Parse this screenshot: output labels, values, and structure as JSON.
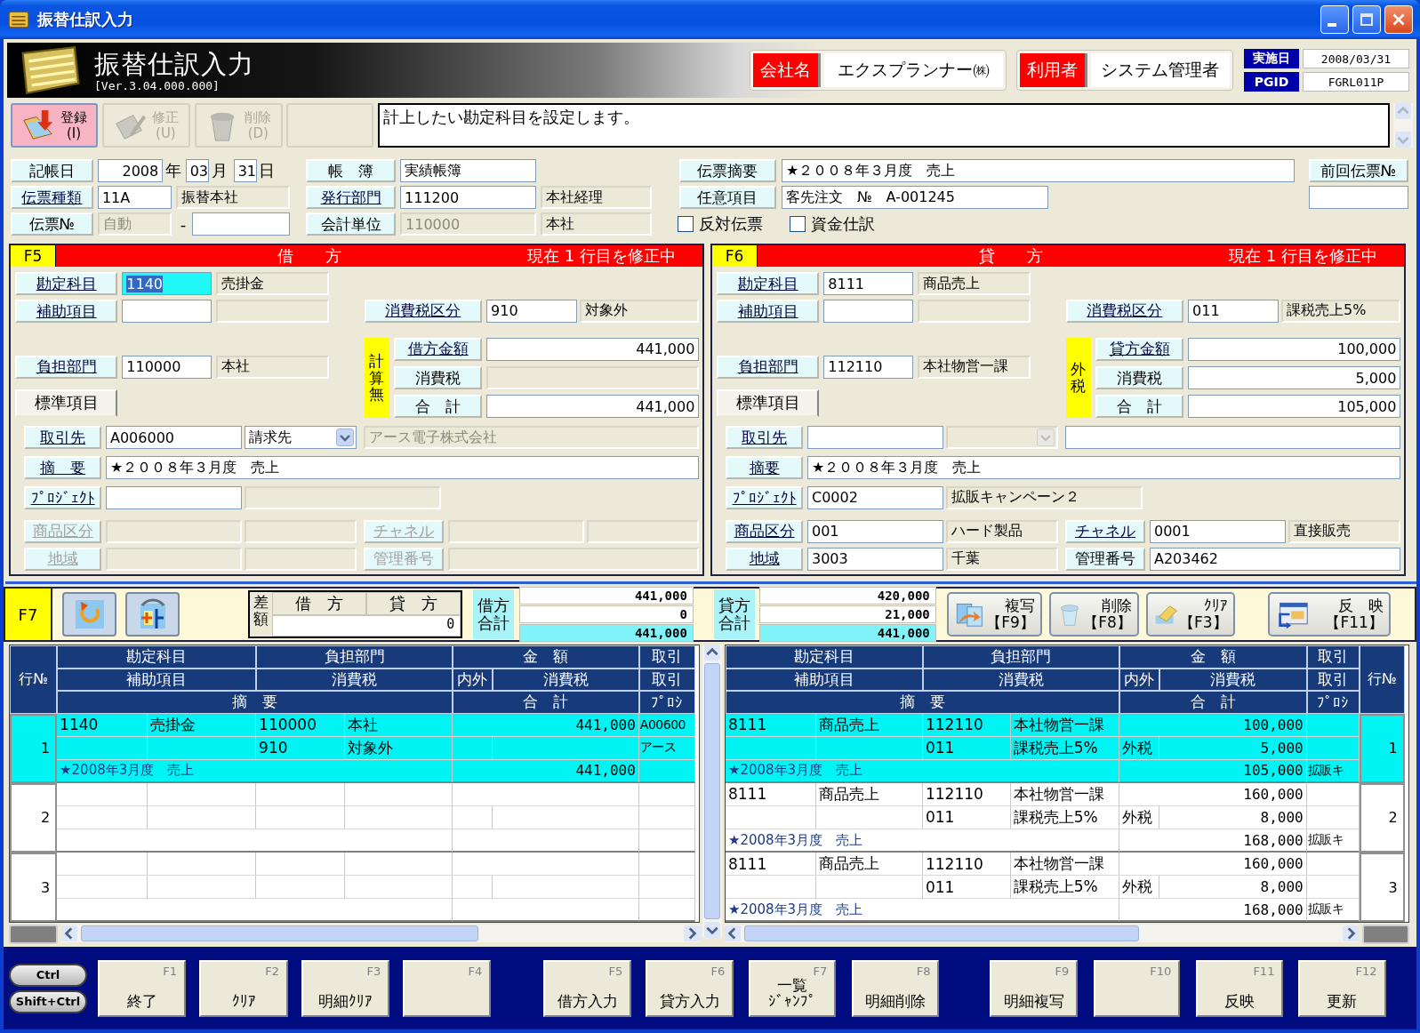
{
  "window": {
    "title": "振替仕訳入力"
  },
  "banner": {
    "title": "振替仕訳入力",
    "version": "[Ver.3.04.000.000]",
    "company_label": "会社名",
    "company": "エクスプランナー㈱",
    "user_label": "利用者",
    "user": "システム管理者",
    "date_label": "実施日",
    "date": "2008/03/31",
    "pgid_label": "PGID",
    "pgid": "FGRL011P"
  },
  "toolbar": {
    "buttons": [
      {
        "label": "登録",
        "key": "(I)",
        "disabled": false
      },
      {
        "label": "修正",
        "key": "(U)",
        "disabled": true
      },
      {
        "label": "削除",
        "key": "(D)",
        "disabled": true
      },
      {
        "disabled": true
      }
    ],
    "message": "計上したい勘定科目を設定します。"
  },
  "header": {
    "left": [
      {
        "label": "記帳日",
        "link": false,
        "cells": [
          {
            "kind": "input",
            "value": "2008"
          },
          {
            "kind": "text",
            "value": "年"
          },
          {
            "kind": "input",
            "value": "03"
          },
          {
            "kind": "text",
            "value": "月"
          },
          {
            "kind": "input",
            "value": "31"
          },
          {
            "kind": "text",
            "value": "日"
          }
        ]
      },
      {
        "label": "伝票種類",
        "link": true,
        "cells": [
          {
            "kind": "input",
            "value": "11A"
          },
          {
            "kind": "readonly",
            "value": "振替本社"
          }
        ]
      },
      {
        "label": "伝票№",
        "link": false,
        "cells": [
          {
            "kind": "disabled",
            "value": "自動"
          },
          {
            "kind": "text",
            "value": "-"
          },
          {
            "kind": "input"
          }
        ]
      }
    ],
    "middle": [
      {
        "label": "帳　簿",
        "link": false,
        "cells": [
          {
            "kind": "input",
            "value": "実績帳簿"
          }
        ]
      },
      {
        "label": "発行部門",
        "link": true,
        "cells": [
          {
            "kind": "input",
            "value": "111200"
          },
          {
            "kind": "readonly",
            "value": "本社経理"
          }
        ]
      },
      {
        "label": "会計単位",
        "link": false,
        "cells": [
          {
            "kind": "disabled",
            "value": "110000"
          },
          {
            "kind": "readonly",
            "value": "本社"
          }
        ]
      }
    ],
    "right": [
      {
        "label": "伝票摘要",
        "link": false,
        "cells": [
          {
            "kind": "input",
            "value": "★２００８年３月度　売上"
          }
        ]
      },
      {
        "label": "任意項目",
        "link": false,
        "cells": [
          {
            "kind": "input",
            "value": "客先注文　№　A-001245"
          }
        ]
      }
    ],
    "checkboxes": [
      {
        "label": "反対伝票",
        "checked": false
      },
      {
        "label": "資金仕訳",
        "checked": false
      }
    ],
    "previous_slip": {
      "label": "前回伝票№"
    }
  },
  "debit": {
    "key": "F5",
    "title": "借　　方",
    "status": "現在 1 行目を修正中",
    "fields": [
      {
        "label": "勘定科目",
        "link": true,
        "disabled": false,
        "cells": [
          {
            "kind": "input",
            "value": "1140",
            "focused": true
          },
          {
            "kind": "readonly",
            "value": "売掛金"
          }
        ]
      },
      {
        "label": "補助項目",
        "link": true,
        "disabled": false,
        "cells": [
          {
            "kind": "input"
          },
          {
            "kind": "readonly"
          }
        ]
      },
      {
        "label": "負担部門",
        "link": true,
        "disabled": false,
        "cells": [
          {
            "kind": "input",
            "value": "110000"
          },
          {
            "kind": "readonly",
            "value": "本社"
          }
        ]
      }
    ],
    "tax_class": {
      "label": "消費税区分",
      "link": true,
      "disabled": false,
      "cells": [
        {
          "kind": "input",
          "value": "910"
        },
        {
          "kind": "readonly",
          "value": "対象外"
        }
      ]
    },
    "tax": {
      "tag": "計算無",
      "rows": [
        {
          "label": "借方金額",
          "link": true,
          "disabled": false,
          "cells": [
            {
              "kind": "input",
              "value": "441,000"
            }
          ]
        },
        {
          "label": "消費税",
          "link": false,
          "disabled": false,
          "cells": [
            {
              "kind": "readonly"
            }
          ]
        },
        {
          "label": "合　計",
          "link": false,
          "disabled": false,
          "cells": [
            {
              "kind": "input",
              "value": "441,000"
            }
          ]
        }
      ]
    },
    "tab": "標準項目",
    "details": [
      {
        "groups": [
          {
            "label": "取引先",
            "link": true,
            "disabled": false,
            "cells": [
              {
                "kind": "input",
                "value": "A006000"
              },
              {
                "kind": "select",
                "value": "請求先"
              },
              {
                "kind": "disabled",
                "value": "アース電子株式会社"
              }
            ]
          }
        ]
      },
      {
        "groups": [
          {
            "label": "摘　要",
            "link": true,
            "disabled": false,
            "cells": [
              {
                "kind": "input",
                "value": "★２００８年３月度　売上"
              }
            ]
          }
        ]
      },
      {
        "groups": [
          {
            "label": "ﾌﾟﾛｼﾞｪｸﾄ",
            "link": true,
            "disabled": false,
            "cells": [
              {
                "kind": "input"
              },
              {
                "kind": "readonly"
              }
            ]
          }
        ]
      },
      {
        "groups": [
          {
            "label": "商品区分",
            "link": true,
            "disabled": true,
            "cells": [
              {
                "kind": "readonly"
              },
              {
                "kind": "readonly"
              }
            ]
          },
          {
            "label": "チャネル",
            "link": true,
            "disabled": true,
            "cells": [
              {
                "kind": "readonly"
              },
              {
                "kind": "readonly"
              }
            ]
          }
        ]
      },
      {
        "groups": [
          {
            "label": "地域",
            "link": true,
            "disabled": true,
            "cells": [
              {
                "kind": "readonly"
              },
              {
                "kind": "readonly"
              }
            ]
          },
          {
            "label": "管理番号",
            "link": false,
            "disabled": true,
            "cells": [
              {
                "kind": "readonly"
              }
            ]
          }
        ]
      }
    ]
  },
  "credit": {
    "key": "F6",
    "title": "貸　　方",
    "status": "現在 1 行目を修正中",
    "fields": [
      {
        "label": "勘定科目",
        "link": true,
        "disabled": false,
        "cells": [
          {
            "kind": "input",
            "value": "8111",
            "focused": false
          },
          {
            "kind": "readonly",
            "value": "商品売上"
          }
        ]
      },
      {
        "label": "補助項目",
        "link": true,
        "disabled": false,
        "cells": [
          {
            "kind": "input"
          },
          {
            "kind": "readonly"
          }
        ]
      },
      {
        "label": "負担部門",
        "link": true,
        "disabled": false,
        "cells": [
          {
            "kind": "input",
            "value": "112110"
          },
          {
            "kind": "readonly",
            "value": "本社物営一課"
          }
        ]
      }
    ],
    "tax_class": {
      "label": "消費税区分",
      "link": true,
      "disabled": false,
      "cells": [
        {
          "kind": "input",
          "value": "011"
        },
        {
          "kind": "readonly",
          "value": "課税売上5%"
        }
      ]
    },
    "tax": {
      "tag": "外税",
      "rows": [
        {
          "label": "貸方金額",
          "link": true,
          "disabled": false,
          "cells": [
            {
              "kind": "input",
              "value": "100,000"
            }
          ]
        },
        {
          "label": "消費税",
          "link": false,
          "disabled": false,
          "cells": [
            {
              "kind": "input",
              "value": "5,000"
            }
          ]
        },
        {
          "label": "合　計",
          "link": false,
          "disabled": false,
          "cells": [
            {
              "kind": "input",
              "value": "105,000"
            }
          ]
        }
      ]
    },
    "tab": "標準項目",
    "details": [
      {
        "groups": [
          {
            "label": "取引先",
            "link": true,
            "disabled": false,
            "cells": [
              {
                "kind": "input"
              },
              {
                "kind": "select-disabled"
              },
              {
                "kind": "input"
              }
            ]
          }
        ]
      },
      {
        "groups": [
          {
            "label": "摘要",
            "link": true,
            "disabled": false,
            "cells": [
              {
                "kind": "input",
                "value": "★２００８年３月度　売上"
              }
            ]
          }
        ]
      },
      {
        "groups": [
          {
            "label": "ﾌﾟﾛｼﾞｪｸﾄ",
            "link": true,
            "disabled": false,
            "cells": [
              {
                "kind": "input",
                "value": "C0002"
              },
              {
                "kind": "readonly",
                "value": "拡販キャンペーン２"
              }
            ]
          }
        ]
      },
      {
        "groups": [
          {
            "label": "商品区分",
            "link": true,
            "disabled": false,
            "cells": [
              {
                "kind": "input",
                "value": "001"
              },
              {
                "kind": "readonly",
                "value": "ハード製品"
              }
            ]
          },
          {
            "label": "チャネル",
            "link": true,
            "disabled": false,
            "cells": [
              {
                "kind": "input",
                "value": "0001"
              },
              {
                "kind": "readonly",
                "value": "直接販売"
              }
            ]
          }
        ]
      },
      {
        "groups": [
          {
            "label": "地域",
            "link": true,
            "disabled": false,
            "cells": [
              {
                "kind": "input",
                "value": "3003"
              },
              {
                "kind": "readonly",
                "value": "千葉"
              }
            ]
          },
          {
            "label": "管理番号",
            "link": false,
            "disabled": false,
            "cells": [
              {
                "kind": "input",
                "value": "A203462"
              }
            ]
          }
        ]
      }
    ]
  },
  "summary": {
    "key": "F7",
    "diff_label": "差額",
    "diff_headers": [
      "借　方",
      "貸　方"
    ],
    "diff": "0",
    "debit_label": "借方合計",
    "debit": [
      "441,000",
      "0",
      "441,000"
    ],
    "credit_label": "貸方合計",
    "credit": [
      "420,000",
      "21,000",
      "441,000"
    ],
    "buttons": [
      {
        "label": "複写",
        "key": "【F9】"
      },
      {
        "label": "削除",
        "key": "【F8】"
      },
      {
        "label": "ｸﾘｱ",
        "key": "【F3】"
      },
      {
        "label": "反　映",
        "key": "【F11】"
      }
    ]
  },
  "debit_table": {
    "headers": {
      "row_no": "行№",
      "line1": [
        "勘定科目",
        "負担部門",
        "金　額",
        "取引"
      ],
      "line2": [
        "補助項目",
        "消費税",
        "内外",
        "消費税",
        "取引"
      ],
      "line3": [
        "摘　要",
        "合　計",
        "ﾌﾟﾛｼ"
      ]
    },
    "rows": [
      {
        "no": "1",
        "selected": true,
        "account": "1140",
        "account_name": "売掛金",
        "dept": "110000",
        "dept_name": "本社",
        "amount": "441,000",
        "column_6": "A00600",
        "tax_code": "910",
        "tax_name": "対象外",
        "column_7": "アース",
        "memo": "★2008年3月度　売上",
        "total": "441,000"
      },
      {
        "no": "2",
        "selected": false
      },
      {
        "no": "3",
        "selected": false
      }
    ]
  },
  "credit_table": {
    "headers": {
      "row_no": "行№",
      "line1": [
        "勘定科目",
        "負担部門",
        "金　額",
        "取引"
      ],
      "line2": [
        "補助項目",
        "消費税",
        "内外",
        "消費税",
        "取引"
      ],
      "line3": [
        "摘　要",
        "合　計",
        "ﾌﾟﾛｼ"
      ]
    },
    "rows": [
      {
        "no": "1",
        "selected": true,
        "account": "8111",
        "account_name": "商品売上",
        "dept": "112110",
        "dept_name": "本社物営一課",
        "amount": "100,000",
        "tax_code": "011",
        "tax_name": "課税売上5%",
        "tax_type": "外税",
        "tax": "5,000",
        "memo": "★2008年3月度　売上",
        "total": "105,000",
        "column_8": "拡販キ"
      },
      {
        "no": "2",
        "selected": false,
        "account": "8111",
        "account_name": "商品売上",
        "dept": "112110",
        "dept_name": "本社物営一課",
        "amount": "160,000",
        "tax_code": "011",
        "tax_name": "課税売上5%",
        "tax_type": "外税",
        "tax": "8,000",
        "memo": "★2008年3月度　売上",
        "total": "168,000",
        "column_8": "拡販キ"
      },
      {
        "no": "3",
        "selected": false,
        "account": "8111",
        "account_name": "商品売上",
        "dept": "112110",
        "dept_name": "本社物営一課",
        "amount": "160,000",
        "tax_code": "011",
        "tax_name": "課税売上5%",
        "tax_type": "外税",
        "tax": "8,000",
        "memo": "★2008年3月度　売上",
        "total": "168,000",
        "column_8": "拡販キ"
      }
    ]
  },
  "function_keys": {
    "modifiers": [
      "Ctrl",
      "Shift+Ctrl"
    ],
    "keys": [
      {
        "key": "F1",
        "lines": [
          "終了"
        ]
      },
      {
        "key": "F2",
        "lines": [
          "ｸﾘｱ"
        ]
      },
      {
        "key": "F3",
        "lines": [
          "明細ｸﾘｱ"
        ]
      },
      {
        "key": "F4"
      },
      {
        "key": "F5",
        "lines": [
          "借方入力"
        ]
      },
      {
        "key": "F6",
        "lines": [
          "貸方入力"
        ]
      },
      {
        "key": "F7",
        "lines": [
          "一覧",
          "ｼﾞｬﾝﾌﾟ"
        ]
      },
      {
        "key": "F8",
        "lines": [
          "明細削除"
        ]
      },
      {
        "key": "F9",
        "lines": [
          "明細複写"
        ]
      },
      {
        "key": "F10"
      },
      {
        "key": "F11",
        "lines": [
          "反映"
        ]
      },
      {
        "key": "F12",
        "lines": [
          "更新"
        ]
      }
    ]
  }
}
